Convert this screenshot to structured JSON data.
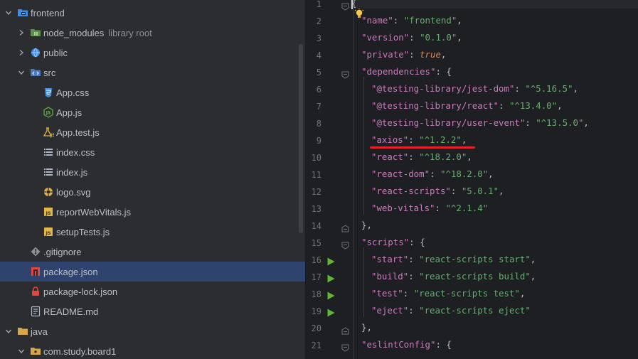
{
  "tree": [
    {
      "label": "frontend",
      "hint": "",
      "level": 0,
      "expanded": true,
      "icon": "folder-module-icon",
      "state": ""
    },
    {
      "label": "node_modules",
      "hint": "library root",
      "level": 1,
      "expanded": false,
      "icon": "folder-library-icon",
      "state": ""
    },
    {
      "label": "public",
      "hint": "",
      "level": 1,
      "expanded": false,
      "icon": "folder-web-icon",
      "state": ""
    },
    {
      "label": "src",
      "hint": "",
      "level": 1,
      "expanded": true,
      "icon": "folder-source-icon",
      "state": ""
    },
    {
      "label": "App.css",
      "hint": "",
      "level": 2,
      "expanded": null,
      "icon": "css-file-icon",
      "state": ""
    },
    {
      "label": "App.js",
      "hint": "",
      "level": 2,
      "expanded": null,
      "icon": "nodejs-file-icon",
      "state": ""
    },
    {
      "label": "App.test.js",
      "hint": "",
      "level": 2,
      "expanded": null,
      "icon": "test-file-icon",
      "state": ""
    },
    {
      "label": "index.css",
      "hint": "",
      "level": 2,
      "expanded": null,
      "icon": "list-file-icon",
      "state": ""
    },
    {
      "label": "index.js",
      "hint": "",
      "level": 2,
      "expanded": null,
      "icon": "list-file-icon",
      "state": ""
    },
    {
      "label": "logo.svg",
      "hint": "",
      "level": 2,
      "expanded": null,
      "icon": "svg-file-icon",
      "state": ""
    },
    {
      "label": "reportWebVitals.js",
      "hint": "",
      "level": 2,
      "expanded": null,
      "icon": "js-file-icon",
      "state": ""
    },
    {
      "label": "setupTests.js",
      "hint": "",
      "level": 2,
      "expanded": null,
      "icon": "js-file-icon",
      "state": ""
    },
    {
      "label": ".gitignore",
      "hint": "",
      "level": 1,
      "expanded": null,
      "icon": "git-file-icon",
      "state": ""
    },
    {
      "label": "package.json",
      "hint": "",
      "level": 1,
      "expanded": null,
      "icon": "npm-file-icon",
      "state": "selected"
    },
    {
      "label": "package-lock.json",
      "hint": "",
      "level": 1,
      "expanded": null,
      "icon": "lock-file-icon",
      "state": ""
    },
    {
      "label": "README.md",
      "hint": "",
      "level": 1,
      "expanded": null,
      "icon": "markdown-file-icon",
      "state": ""
    },
    {
      "label": "java",
      "hint": "",
      "level": 0,
      "expanded": true,
      "icon": "folder-plain-icon",
      "state": ""
    },
    {
      "label": "com.study.board1",
      "hint": "",
      "level": 1,
      "expanded": true,
      "icon": "folder-package-icon",
      "state": ""
    }
  ],
  "editor": {
    "lines": [
      {
        "n": "1",
        "parts": [
          [
            "br",
            "{"
          ]
        ],
        "indent": 0,
        "fold": "open",
        "run": false
      },
      {
        "n": "2",
        "parts": [
          [
            "key",
            "\"name\""
          ],
          [
            "pun",
            ": "
          ],
          [
            "str",
            "\"frontend\""
          ],
          [
            "pun",
            ","
          ]
        ],
        "indent": 1,
        "fold": "",
        "run": false
      },
      {
        "n": "3",
        "parts": [
          [
            "key",
            "\"version\""
          ],
          [
            "pun",
            ": "
          ],
          [
            "str",
            "\"0.1.0\""
          ],
          [
            "pun",
            ","
          ]
        ],
        "indent": 1,
        "fold": "",
        "run": false
      },
      {
        "n": "4",
        "parts": [
          [
            "key",
            "\"private\""
          ],
          [
            "pun",
            ": "
          ],
          [
            "kw",
            "true"
          ],
          [
            "pun",
            ","
          ]
        ],
        "indent": 1,
        "fold": "",
        "run": false
      },
      {
        "n": "5",
        "parts": [
          [
            "key",
            "\"dependencies\""
          ],
          [
            "pun",
            ": "
          ],
          [
            "br",
            "{"
          ]
        ],
        "indent": 1,
        "fold": "open",
        "run": false
      },
      {
        "n": "6",
        "parts": [
          [
            "key",
            "\"@testing-library/jest-dom\""
          ],
          [
            "pun",
            ": "
          ],
          [
            "str",
            "\"^5.16.5\""
          ],
          [
            "pun",
            ","
          ]
        ],
        "indent": 2,
        "fold": "",
        "run": false
      },
      {
        "n": "7",
        "parts": [
          [
            "key",
            "\"@testing-library/react\""
          ],
          [
            "pun",
            ": "
          ],
          [
            "str",
            "\"^13.4.0\""
          ],
          [
            "pun",
            ","
          ]
        ],
        "indent": 2,
        "fold": "",
        "run": false
      },
      {
        "n": "8",
        "parts": [
          [
            "key",
            "\"@testing-library/user-event\""
          ],
          [
            "pun",
            ": "
          ],
          [
            "str",
            "\"^13.5.0\""
          ],
          [
            "pun",
            ","
          ]
        ],
        "indent": 2,
        "fold": "",
        "run": false
      },
      {
        "n": "9",
        "parts": [
          [
            "key",
            "\"axios\""
          ],
          [
            "pun",
            ": "
          ],
          [
            "str",
            "\"^1.2.2\""
          ],
          [
            "pun",
            ","
          ]
        ],
        "indent": 2,
        "fold": "",
        "run": false
      },
      {
        "n": "10",
        "parts": [
          [
            "key",
            "\"react\""
          ],
          [
            "pun",
            ": "
          ],
          [
            "str",
            "\"^18.2.0\""
          ],
          [
            "pun",
            ","
          ]
        ],
        "indent": 2,
        "fold": "",
        "run": false
      },
      {
        "n": "11",
        "parts": [
          [
            "key",
            "\"react-dom\""
          ],
          [
            "pun",
            ": "
          ],
          [
            "str",
            "\"^18.2.0\""
          ],
          [
            "pun",
            ","
          ]
        ],
        "indent": 2,
        "fold": "",
        "run": false
      },
      {
        "n": "12",
        "parts": [
          [
            "key",
            "\"react-scripts\""
          ],
          [
            "pun",
            ": "
          ],
          [
            "str",
            "\"5.0.1\""
          ],
          [
            "pun",
            ","
          ]
        ],
        "indent": 2,
        "fold": "",
        "run": false
      },
      {
        "n": "13",
        "parts": [
          [
            "key",
            "\"web-vitals\""
          ],
          [
            "pun",
            ": "
          ],
          [
            "str",
            "\"^2.1.4\""
          ]
        ],
        "indent": 2,
        "fold": "",
        "run": false
      },
      {
        "n": "14",
        "parts": [
          [
            "br",
            "}"
          ],
          [
            "pun",
            ","
          ]
        ],
        "indent": 1,
        "fold": "close",
        "run": false
      },
      {
        "n": "15",
        "parts": [
          [
            "key",
            "\"scripts\""
          ],
          [
            "pun",
            ": "
          ],
          [
            "br",
            "{"
          ]
        ],
        "indent": 1,
        "fold": "open",
        "run": false
      },
      {
        "n": "16",
        "parts": [
          [
            "key",
            "\"start\""
          ],
          [
            "pun",
            ": "
          ],
          [
            "str",
            "\"react-scripts start\""
          ],
          [
            "pun",
            ","
          ]
        ],
        "indent": 2,
        "fold": "",
        "run": true
      },
      {
        "n": "17",
        "parts": [
          [
            "key",
            "\"build\""
          ],
          [
            "pun",
            ": "
          ],
          [
            "str",
            "\"react-scripts build\""
          ],
          [
            "pun",
            ","
          ]
        ],
        "indent": 2,
        "fold": "",
        "run": true
      },
      {
        "n": "18",
        "parts": [
          [
            "key",
            "\"test\""
          ],
          [
            "pun",
            ": "
          ],
          [
            "str",
            "\"react-scripts test\""
          ],
          [
            "pun",
            ","
          ]
        ],
        "indent": 2,
        "fold": "",
        "run": true
      },
      {
        "n": "19",
        "parts": [
          [
            "key",
            "\"eject\""
          ],
          [
            "pun",
            ": "
          ],
          [
            "str",
            "\"react-scripts eject\""
          ]
        ],
        "indent": 2,
        "fold": "",
        "run": true
      },
      {
        "n": "20",
        "parts": [
          [
            "br",
            "}"
          ],
          [
            "pun",
            ","
          ]
        ],
        "indent": 1,
        "fold": "close",
        "run": false
      },
      {
        "n": "21",
        "parts": [
          [
            "key",
            "\"eslintConfig\""
          ],
          [
            "pun",
            ": "
          ],
          [
            "br",
            "{"
          ]
        ],
        "indent": 1,
        "fold": "open",
        "run": false
      }
    ],
    "highlight_line": "9"
  },
  "colors": {
    "selection": "#2e436e",
    "underline": "#e4222b",
    "run": "#5fb832"
  }
}
